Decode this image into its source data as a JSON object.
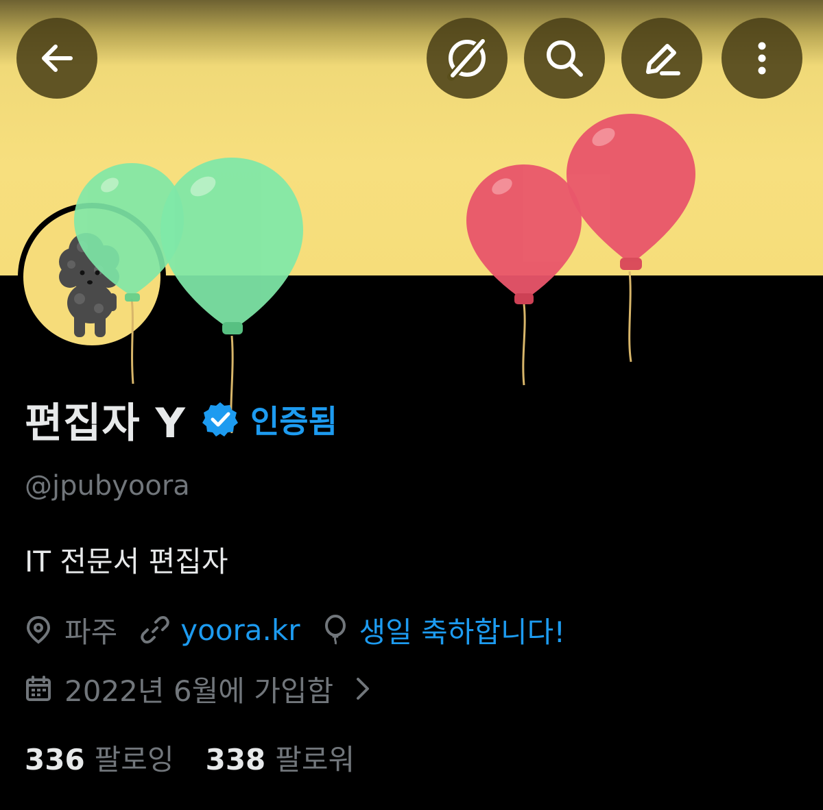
{
  "header": {
    "back_icon": "arrow-left-icon",
    "actions": [
      "grok-icon",
      "search-icon",
      "edit-icon",
      "more-vertical-icon"
    ]
  },
  "banner": {
    "description_icons": [
      "green-balloon",
      "red-balloon"
    ],
    "colors": {
      "background": "#f6dd7a",
      "green": "#7ee6a8",
      "red": "#e9566b"
    }
  },
  "profile": {
    "display_name": "편집자 Y",
    "verified_label": "인증됨",
    "handle": "@jpubyoora",
    "bio": "IT 전문서 편집자",
    "location": "파주",
    "website": "yoora.kr",
    "birthday_message": "생일 축하합니다!",
    "joined": "2022년 6월에 가입함",
    "following_count": "336",
    "following_label": "팔로잉",
    "followers_count": "338",
    "followers_label": "팔로워"
  },
  "colors": {
    "accent": "#1d9bf0",
    "text_primary": "#e7e9ea",
    "text_secondary": "#71767b",
    "background": "#000000"
  }
}
